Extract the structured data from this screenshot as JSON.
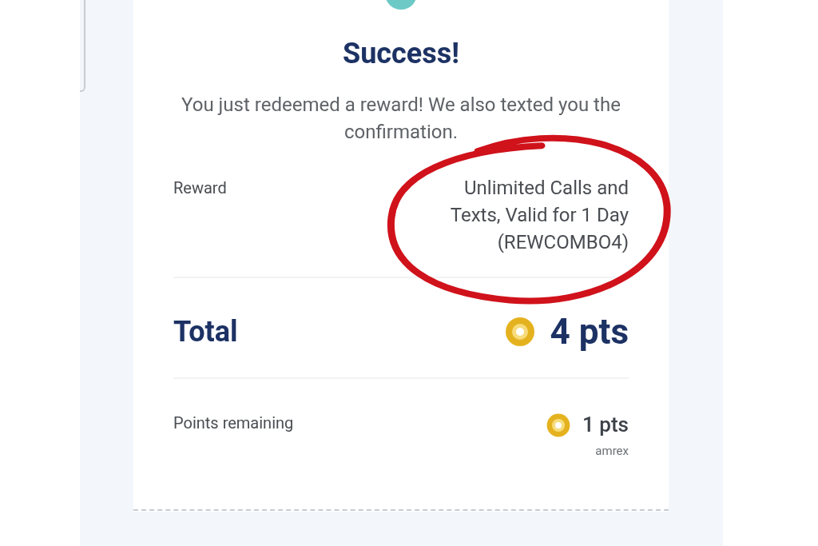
{
  "title": "Success!",
  "message": "You just redeemed a reward! We also texted you the confirmation.",
  "reward": {
    "label": "Reward",
    "value": "Unlimited Calls and Texts, Valid for 1 Day (REWCOMBO4)"
  },
  "total": {
    "label": "Total",
    "value": "4 pts"
  },
  "points_remaining": {
    "label": "Points remaining",
    "value": "1 pts",
    "account": "amrex"
  }
}
